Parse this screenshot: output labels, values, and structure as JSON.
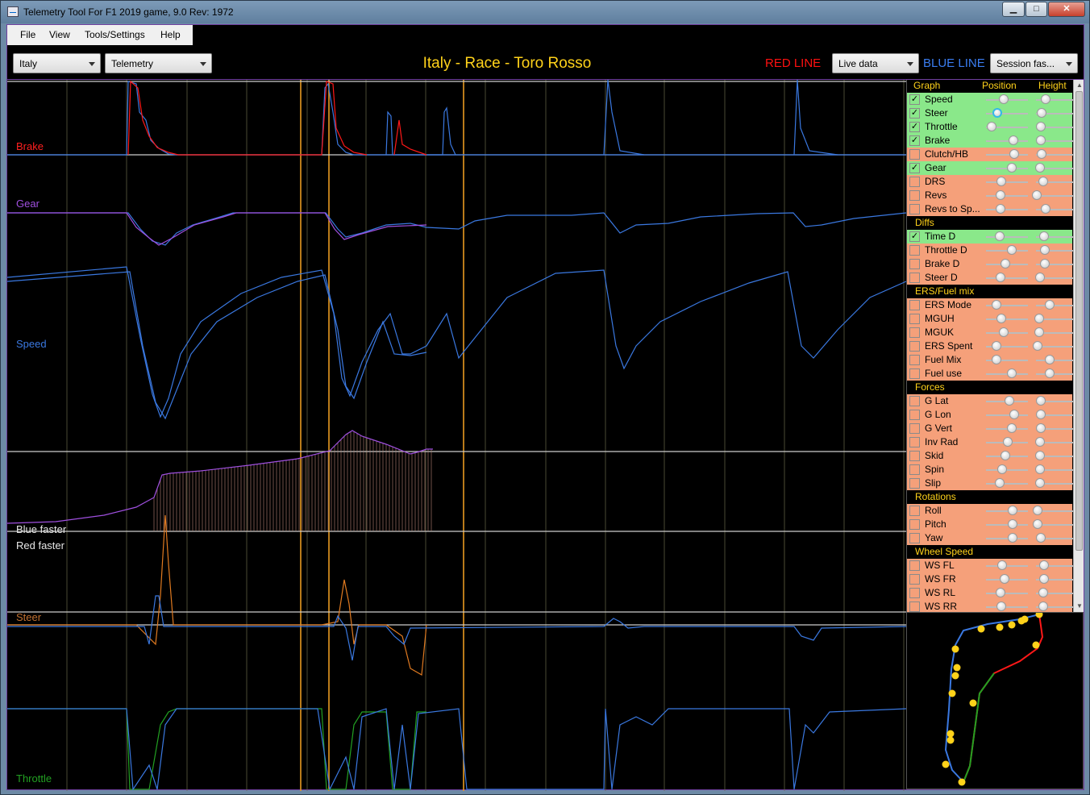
{
  "window": {
    "title": "Telemetry Tool For F1 2019 game, 9.0 Rev: 1972",
    "min_glyph": "▁",
    "max_glyph": "□",
    "close_glyph": "✕"
  },
  "menu": [
    "File",
    "View",
    "Tools/Settings",
    "Help"
  ],
  "toolbar": {
    "track_select": "Italy",
    "mode_select": "Telemetry",
    "title": "Italy - Race - Toro Rosso",
    "red_line_label": "RED LINE",
    "red_line_select": "Live data",
    "blue_line_label": "BLUE LINE",
    "blue_line_select": "Session fas..."
  },
  "colors": {
    "red": "#ff1818",
    "blue": "#3a78e0",
    "gear_label": "#a050e0",
    "speed_label": "#3a78e0",
    "throttle": "#22a022",
    "steer": "#e07a20",
    "cursor": "#e89a20",
    "on_row": "#8ae88a",
    "off_row": "#f5a07a",
    "title": "#ffd21a"
  },
  "graph_labels": {
    "brake": "Brake",
    "gear": "Gear",
    "speed": "Speed",
    "blue_faster": "Blue faster",
    "red_faster": "Red faster",
    "steer": "Steer",
    "throttle": "Throttle"
  },
  "panel": {
    "headers": {
      "graph": "Graph",
      "position": "Position",
      "height": "Height"
    },
    "sections": [
      {
        "title": "",
        "items": [
          {
            "label": "Speed",
            "checked": true,
            "pos": 0.35,
            "height": 0.78
          },
          {
            "label": "Steer",
            "checked": true,
            "pos": 0.2,
            "height": 0.7
          },
          {
            "label": "Throttle",
            "checked": true,
            "pos": 0.05,
            "height": 0.68
          },
          {
            "label": "Brake",
            "checked": true,
            "pos": 0.6,
            "height": 0.68
          },
          {
            "label": "Clutch/HB",
            "checked": false,
            "pos": 0.62,
            "height": 0.7
          },
          {
            "label": "Gear",
            "checked": true,
            "pos": 0.55,
            "height": 0.66
          },
          {
            "label": "DRS",
            "checked": false,
            "pos": 0.3,
            "height": 0.72
          },
          {
            "label": "Revs",
            "checked": false,
            "pos": 0.28,
            "height": 0.6
          },
          {
            "label": "Revs to Sp...",
            "checked": false,
            "pos": 0.28,
            "height": 0.78
          }
        ]
      },
      {
        "title": "Diffs",
        "items": [
          {
            "label": "Time D",
            "checked": true,
            "pos": 0.26,
            "height": 0.74
          },
          {
            "label": "Throttle D",
            "checked": false,
            "pos": 0.55,
            "height": 0.76
          },
          {
            "label": "Brake D",
            "checked": false,
            "pos": 0.4,
            "height": 0.76
          },
          {
            "label": "Steer D",
            "checked": false,
            "pos": 0.28,
            "height": 0.66
          }
        ]
      },
      {
        "title": "ERS/Fuel mix",
        "items": [
          {
            "label": "ERS Mode",
            "checked": false,
            "pos": 0.18,
            "height": 0.85
          },
          {
            "label": "MGUH",
            "checked": false,
            "pos": 0.3,
            "height": 0.64
          },
          {
            "label": "MGUK",
            "checked": false,
            "pos": 0.35,
            "height": 0.64
          },
          {
            "label": "ERS Spent",
            "checked": false,
            "pos": 0.18,
            "height": 0.62
          },
          {
            "label": "Fuel Mix",
            "checked": false,
            "pos": 0.18,
            "height": 0.85
          },
          {
            "label": "Fuel use",
            "checked": false,
            "pos": 0.55,
            "height": 0.85
          }
        ]
      },
      {
        "title": "Forces",
        "items": [
          {
            "label": "G Lat",
            "checked": false,
            "pos": 0.5,
            "height": 0.68
          },
          {
            "label": "G Lon",
            "checked": false,
            "pos": 0.62,
            "height": 0.68
          },
          {
            "label": "G Vert",
            "checked": false,
            "pos": 0.55,
            "height": 0.68
          },
          {
            "label": "Inv Rad",
            "checked": false,
            "pos": 0.45,
            "height": 0.66
          },
          {
            "label": "Skid",
            "checked": false,
            "pos": 0.4,
            "height": 0.66
          },
          {
            "label": "Spin",
            "checked": false,
            "pos": 0.32,
            "height": 0.66
          },
          {
            "label": "Slip",
            "checked": false,
            "pos": 0.25,
            "height": 0.66
          }
        ]
      },
      {
        "title": "Rotations",
        "items": [
          {
            "label": "Roll",
            "checked": false,
            "pos": 0.58,
            "height": 0.62
          },
          {
            "label": "Pitch",
            "checked": false,
            "pos": 0.58,
            "height": 0.62
          },
          {
            "label": "Yaw",
            "checked": false,
            "pos": 0.58,
            "height": 0.68
          }
        ]
      },
      {
        "title": "Wheel Speed",
        "items": [
          {
            "label": "WS FL",
            "checked": false,
            "pos": 0.32,
            "height": 0.74
          },
          {
            "label": "WS FR",
            "checked": false,
            "pos": 0.38,
            "height": 0.74
          },
          {
            "label": "WS RL",
            "checked": false,
            "pos": 0.28,
            "height": 0.72
          },
          {
            "label": "WS RR",
            "checked": false,
            "pos": 0.3,
            "height": 0.72
          }
        ]
      }
    ]
  },
  "check_glyph": "✓"
}
